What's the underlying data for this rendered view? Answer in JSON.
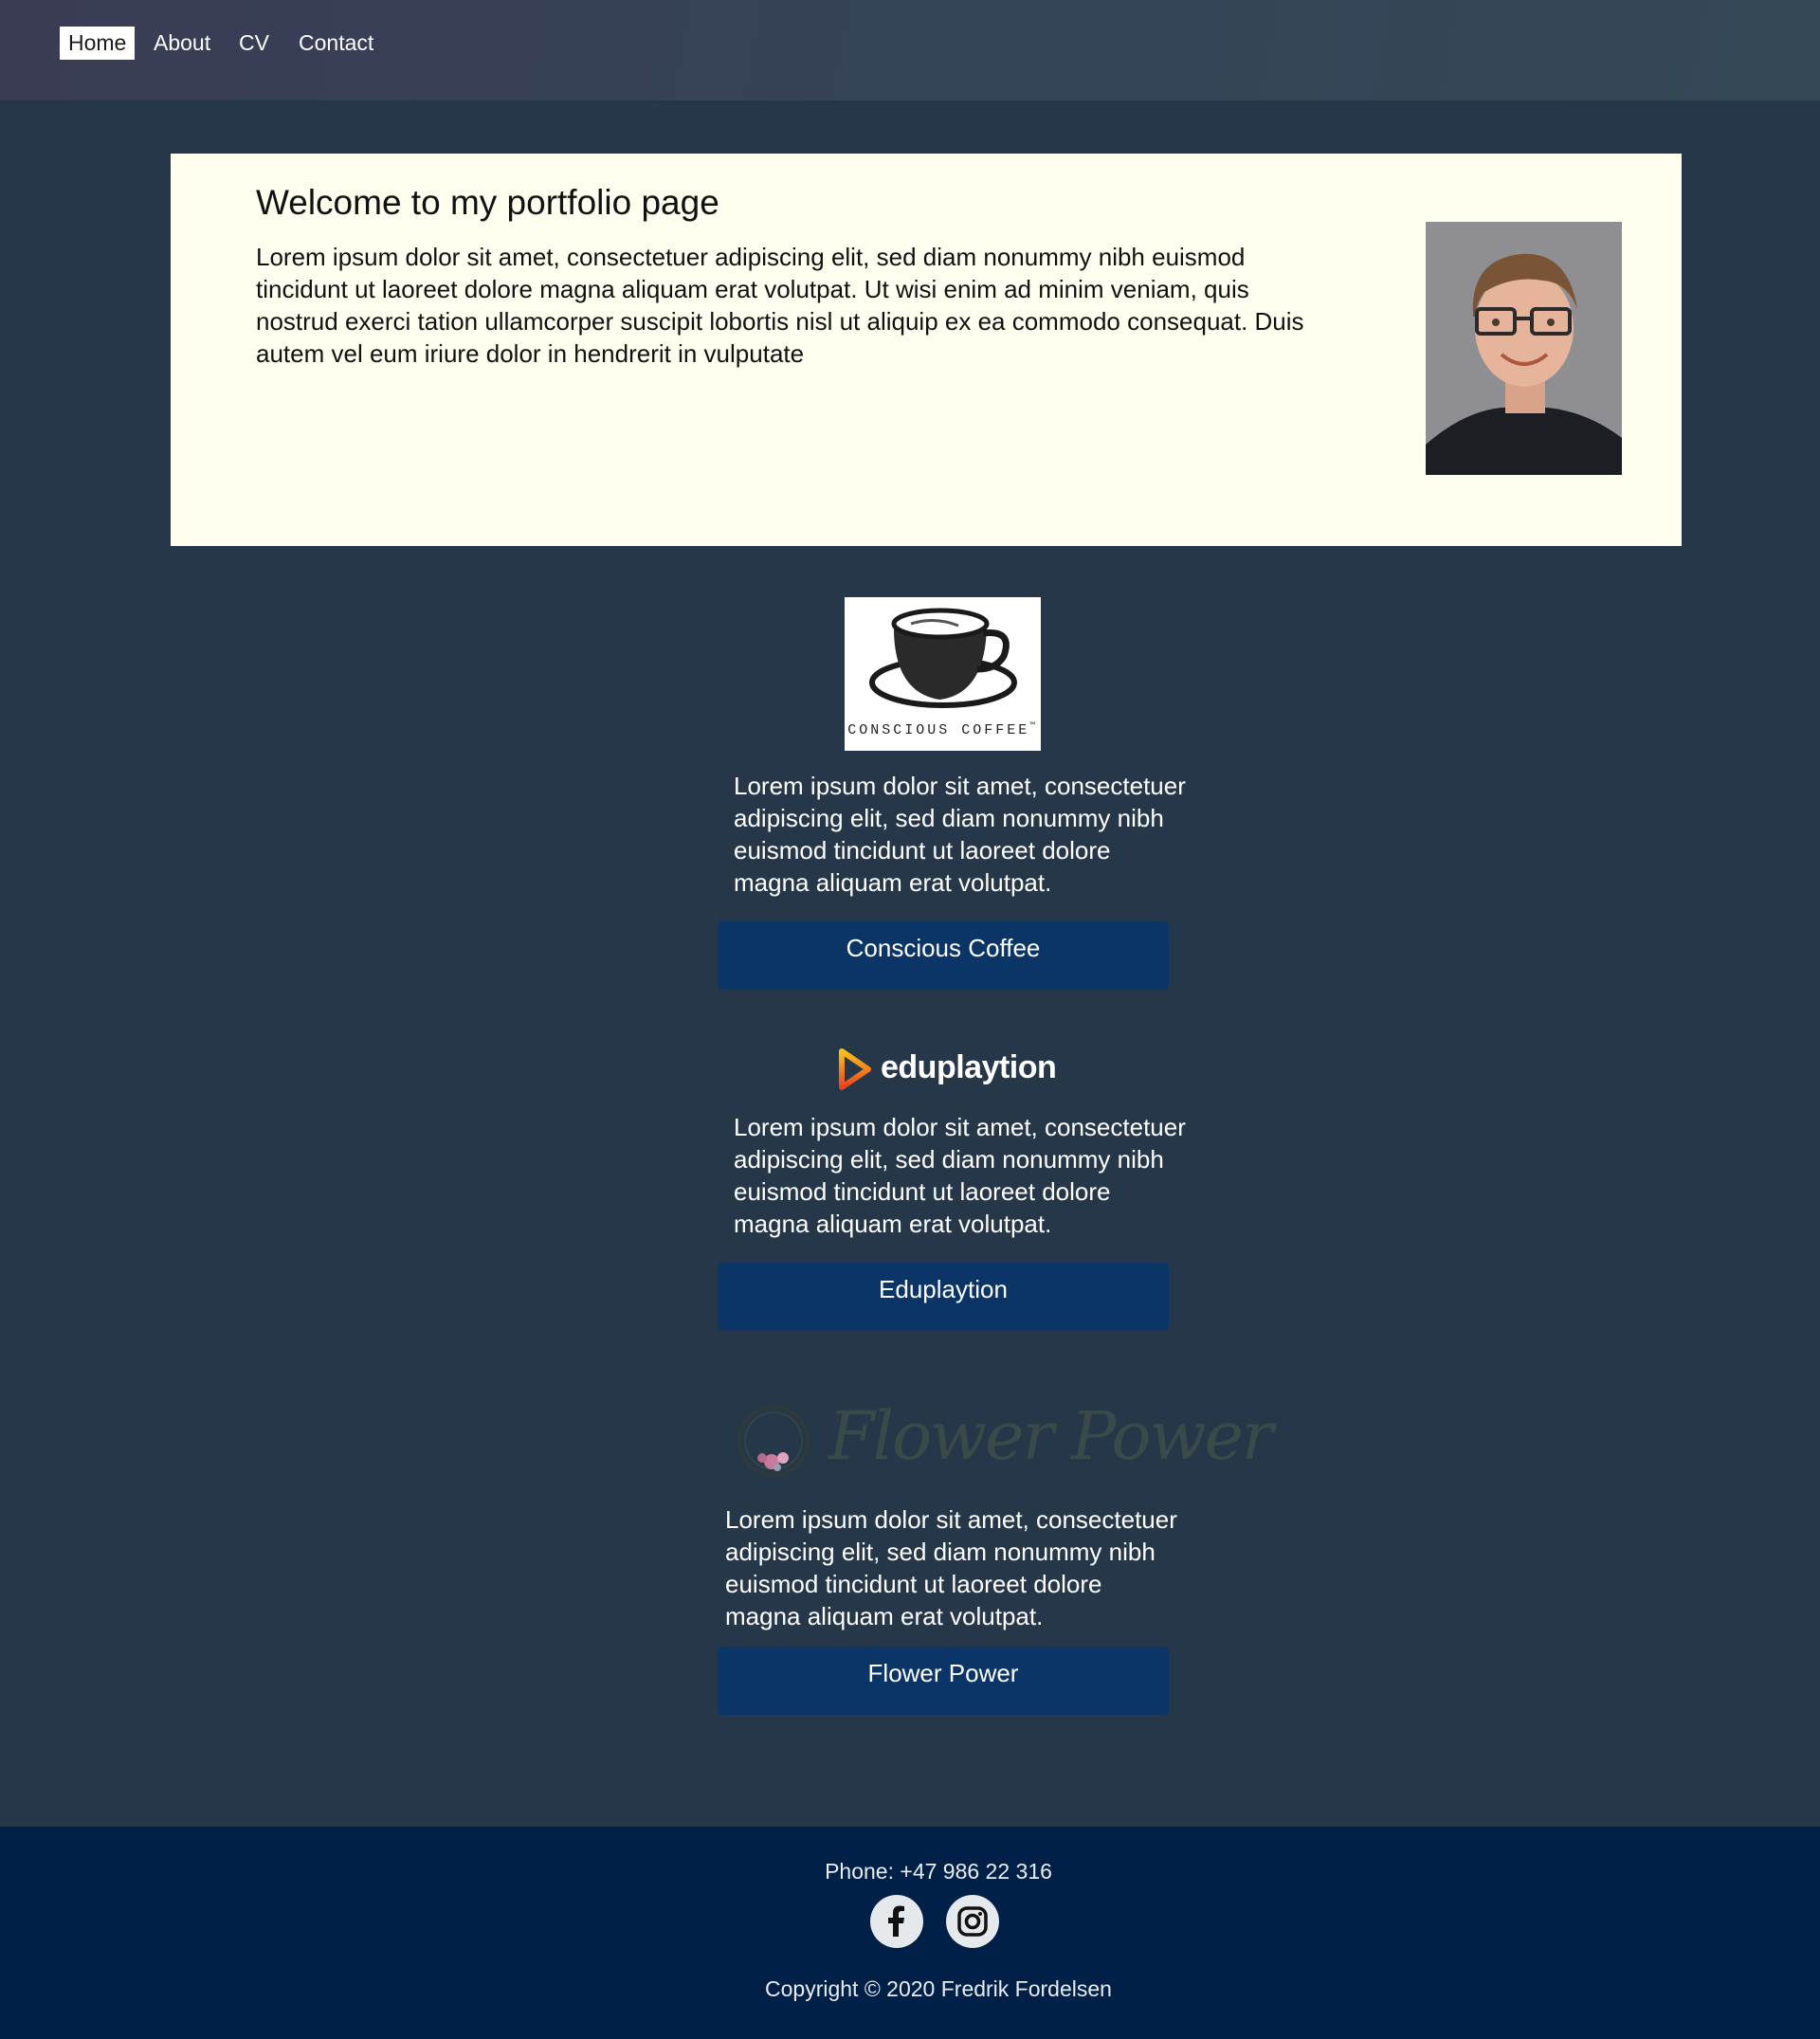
{
  "nav": {
    "items": [
      {
        "label": "Home",
        "active": true
      },
      {
        "label": "About",
        "active": false
      },
      {
        "label": "CV",
        "active": false
      },
      {
        "label": "Contact",
        "active": false
      }
    ]
  },
  "hero": {
    "title": "Welcome to my portfolio page",
    "text": "Lorem ipsum dolor sit amet, consectetuer adipiscing elit, sed diam nonummy nibh euismod tincidunt ut laoreet dolore magna aliquam erat volutpat. Ut wisi enim ad minim veniam, quis nostrud exerci tation ullamcorper suscipit lobortis nisl ut aliquip ex ea commodo consequat. Duis autem vel eum iriure dolor in hendrerit in vulputate"
  },
  "projects": [
    {
      "logo_text": "CONSCIOUS COFFEE",
      "logo_mark": "™",
      "text": "Lorem ipsum dolor sit amet, consectetuer adipiscing elit, sed diam nonummy nibh euismod tincidunt ut laoreet dolore magna aliquam erat volutpat.",
      "button": "Conscious Coffee"
    },
    {
      "logo_text": "eduplaytion",
      "text": "Lorem ipsum dolor sit amet, consectetuer adipiscing elit, sed diam nonummy nibh euismod tincidunt ut laoreet dolore magna aliquam erat volutpat.",
      "button": "Eduplaytion"
    },
    {
      "logo_text": "Flower Power",
      "text": "Lorem ipsum dolor sit amet, consectetuer adipiscing elit, sed diam nonummy nibh euismod tincidunt ut laoreet dolore magna aliquam erat volutpat.",
      "button": "Flower Power"
    }
  ],
  "footer": {
    "phone": "Phone: +47 986 22 316",
    "copyright": "Copyright © 2020 Fredrik Fordelsen",
    "social": [
      "facebook-icon",
      "instagram-icon"
    ]
  },
  "colors": {
    "page_bg": "#27374a",
    "hero_bg": "#fffff0",
    "button_bg": "#0a3566",
    "footer_bg": "#002047"
  }
}
